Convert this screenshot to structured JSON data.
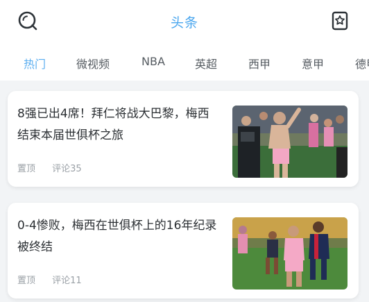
{
  "header": {
    "title": "头条",
    "left_icon": "search-icon",
    "right_icon": "profile-badge-icon"
  },
  "tabs": [
    {
      "label": "热门",
      "active": true
    },
    {
      "label": "微视频",
      "active": false
    },
    {
      "label": "NBA",
      "active": false
    },
    {
      "label": "英超",
      "active": false
    },
    {
      "label": "西甲",
      "active": false
    },
    {
      "label": "意甲",
      "active": false
    },
    {
      "label": "德甲",
      "active": false
    }
  ],
  "articles": [
    {
      "headline": "8强已出4席！拜仁将战大巴黎，梅西结束本届世俱杯之旅",
      "pinned_label": "置顶",
      "comments_label": "评论35"
    },
    {
      "headline": "0-4惨败，梅西在世俱杯上的16年纪录被终结",
      "pinned_label": "置顶",
      "comments_label": "评论11"
    }
  ],
  "colors": {
    "accent": "#4aa6ee",
    "background": "#f2f4f6",
    "text": "#2b2f33",
    "meta": "#9aa0a6"
  }
}
